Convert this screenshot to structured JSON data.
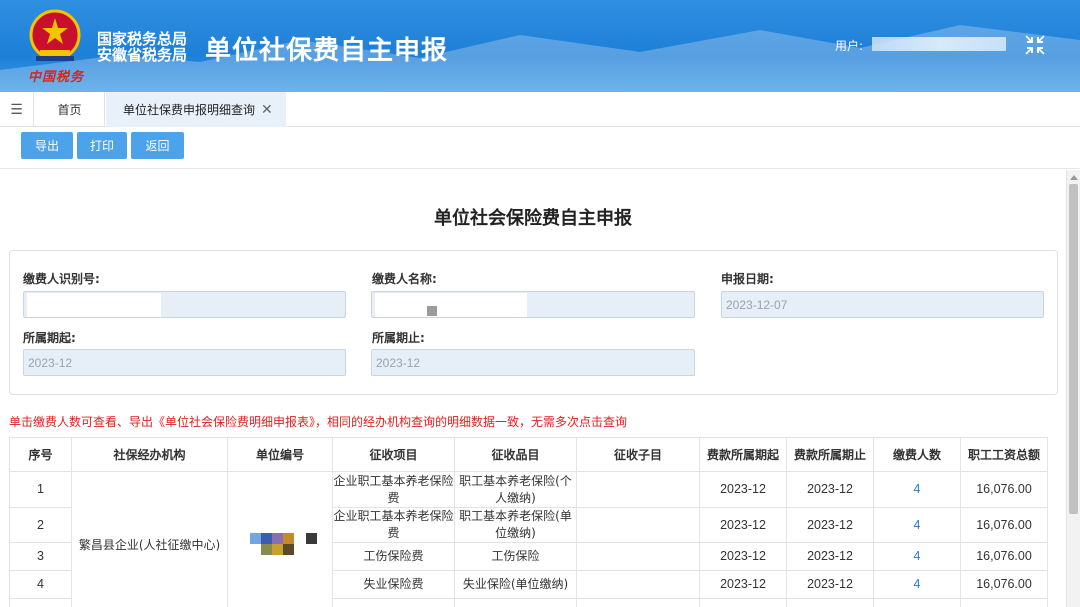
{
  "header": {
    "org_line1": "国家税务总局",
    "org_line2": "安徽省税务局",
    "brand_signature": "中国税务",
    "app_title": "单位社保费自主申报",
    "user_label": "用户:",
    "colors": {
      "header_bg": "#2585dc",
      "accent": "#4da3ea",
      "alert": "#e02020"
    }
  },
  "tabs": {
    "menu_icon": "hamburger-icon",
    "home": "首页",
    "active": "单位社保费申报明细查询",
    "close_glyph": "✕"
  },
  "toolbar": {
    "export_label": "导出",
    "print_label": "打印",
    "back_label": "返回"
  },
  "form": {
    "title": "单位社会保险费自主申报",
    "payer_id_label": "缴费人识别号:",
    "payer_id_value": "",
    "payer_name_label": "缴费人名称:",
    "payer_name_value": "",
    "declare_date_label": "申报日期:",
    "declare_date_value": "2023-12-07",
    "period_start_label": "所属期起:",
    "period_start_value": "2023-12",
    "period_end_label": "所属期止:",
    "period_end_value": "2023-12"
  },
  "notice": "单击缴费人数可查看、导出《单位社会保险费明细申报表》，相同的经办机构查询的明细数据一致，无需多次点击查询",
  "table": {
    "headers": [
      "序号",
      "社保经办机构",
      "单位编号",
      "征收项目",
      "征收品目",
      "征收子目",
      "费款所属期起",
      "费款所属期止",
      "缴费人数",
      "职工工资总额"
    ],
    "agency": "繁昌县企业(人社征缴中心)",
    "rows": [
      {
        "no": "1",
        "item": "企业职工基本养老保险费",
        "category": "职工基本养老保险(个人缴纳)",
        "sub": "",
        "start": "2023-12",
        "end": "2023-12",
        "count": "4",
        "wages": "16,076.00"
      },
      {
        "no": "2",
        "item": "企业职工基本养老保险费",
        "category": "职工基本养老保险(单位缴纳)",
        "sub": "",
        "start": "2023-12",
        "end": "2023-12",
        "count": "4",
        "wages": "16,076.00"
      },
      {
        "no": "3",
        "item": "工伤保险费",
        "category": "工伤保险",
        "sub": "",
        "start": "2023-12",
        "end": "2023-12",
        "count": "4",
        "wages": "16,076.00"
      },
      {
        "no": "4",
        "item": "失业保险费",
        "category": "失业保险(单位缴纳)",
        "sub": "",
        "start": "2023-12",
        "end": "2023-12",
        "count": "4",
        "wages": "16,076.00"
      }
    ]
  }
}
